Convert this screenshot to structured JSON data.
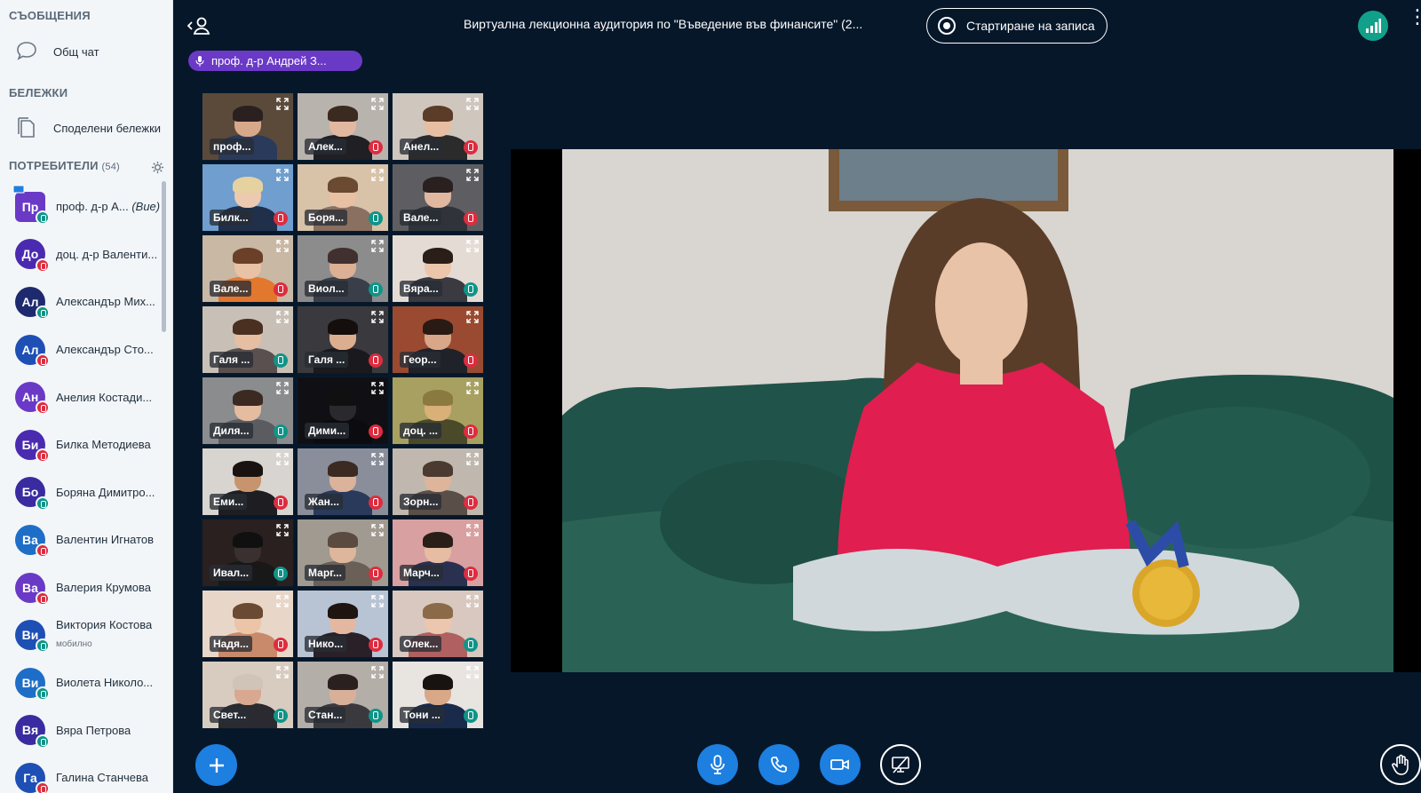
{
  "sidebar": {
    "messages_title": "СЪОБЩЕНИЯ",
    "public_chat": "Общ чат",
    "notes_title": "БЕЛЕЖКИ",
    "shared_notes": "Споделени бележки",
    "users_title": "ПОТРЕБИТЕЛИ",
    "users_count": "(54)",
    "users": [
      {
        "initials": "Пр",
        "name": "проф. д-р А...",
        "suffix": "(Вие)",
        "status": "listen",
        "color": "#6a3ac6",
        "presenter": true
      },
      {
        "initials": "До",
        "name": "доц. д-р Валенти...",
        "status": "mute",
        "color": "#4a2bb0"
      },
      {
        "initials": "Ал",
        "name": "Александър Мих...",
        "status": "listen",
        "color": "#1e2a6e"
      },
      {
        "initials": "Ал",
        "name": "Александър Сто...",
        "status": "mute",
        "color": "#1e4fb5"
      },
      {
        "initials": "Ан",
        "name": "Анелия Костади...",
        "status": "mute",
        "color": "#6a3ac6"
      },
      {
        "initials": "Би",
        "name": "Билка Методиева",
        "status": "mute",
        "color": "#4a2bb0"
      },
      {
        "initials": "Бо",
        "name": "Боряна Димитро...",
        "status": "listen",
        "color": "#3a2ba0"
      },
      {
        "initials": "Ва",
        "name": "Валентин Игнатов",
        "status": "mute",
        "color": "#1e6ec8"
      },
      {
        "initials": "Ва",
        "name": "Валерия Крумова",
        "status": "mute",
        "color": "#6a3ac6"
      },
      {
        "initials": "Ви",
        "name": "Виктория Костова",
        "sub": "мобилно",
        "status": "listen",
        "color": "#1e4fb5"
      },
      {
        "initials": "Ви",
        "name": "Виолета Николо...",
        "status": "listen",
        "color": "#1e6ec8"
      },
      {
        "initials": "Вя",
        "name": "Вяра Петрова",
        "status": "listen",
        "color": "#3a2ba0"
      },
      {
        "initials": "Га",
        "name": "Галина Станчева",
        "status": "mute",
        "color": "#1e4fb5"
      }
    ]
  },
  "header": {
    "title": "Виртуална лекционна аудитория по \"Въведение във финансите\" (2...",
    "record_label": "Стартиране на записа",
    "talker": "проф. д-р Андрей З..."
  },
  "tiles": [
    {
      "name": "проф...",
      "status": "none",
      "bg": "#5b4a3a",
      "skin": "#d8a88a",
      "hair": "#2a2020",
      "shirt": "#2a3a5a"
    },
    {
      "name": "Алек...",
      "status": "mute",
      "bg": "#b9b3ad",
      "skin": "#e2b8a0",
      "hair": "#3b2a20",
      "shirt": "#1f1f24"
    },
    {
      "name": "Анел...",
      "status": "mute",
      "bg": "#cfc6bd",
      "skin": "#e8bea2",
      "hair": "#5a3c28",
      "shirt": "#2b2b2b"
    },
    {
      "name": "Билк...",
      "status": "mute",
      "bg": "#6f9ecf",
      "skin": "#ecc9b0",
      "hair": "#e5d2a0",
      "shirt": "#20304a"
    },
    {
      "name": "Боря...",
      "status": "listen",
      "bg": "#d8c2a8",
      "skin": "#e8c0a4",
      "hair": "#6a4a30",
      "shirt": "#8a7060"
    },
    {
      "name": "Вале...",
      "status": "mute",
      "bg": "#5e5e62",
      "skin": "#e0b8a0",
      "hair": "#2a2020",
      "shirt": "#30343a"
    },
    {
      "name": "Вале...",
      "status": "mute",
      "bg": "#c8b8a4",
      "skin": "#e9c2a5",
      "hair": "#6a4028",
      "shirt": "#e2772e"
    },
    {
      "name": "Виол...",
      "status": "listen",
      "bg": "#8c8c8c",
      "skin": "#dcb094",
      "hair": "#403030",
      "shirt": "#3a3e48"
    },
    {
      "name": "Вяра...",
      "status": "listen",
      "bg": "#e4dcd4",
      "skin": "#ecc6aa",
      "hair": "#2a1e18",
      "shirt": "#3a3a40"
    },
    {
      "name": "Галя ...",
      "status": "listen",
      "bg": "#c8c0b6",
      "skin": "#e6bea2",
      "hair": "#4a3020",
      "shirt": "#5a5050"
    },
    {
      "name": "Галя ...",
      "status": "mute",
      "bg": "#3a3a3e",
      "skin": "#dcae90",
      "hair": "#140e0c",
      "shirt": "#1a1a1e"
    },
    {
      "name": "Геор...",
      "status": "mute",
      "bg": "#9a4a30",
      "skin": "#d8a688",
      "hair": "#2a1a14",
      "shirt": "#20222a"
    },
    {
      "name": "Диля...",
      "status": "listen",
      "bg": "#8a8c8e",
      "skin": "#e4bca0",
      "hair": "#3a2a22",
      "shirt": "#5a5c60"
    },
    {
      "name": "Дими...",
      "status": "mute",
      "bg": "#101014",
      "skin": "#2a2a2e",
      "hair": "#101010",
      "shirt": "#0c0c10"
    },
    {
      "name": "доц. ...",
      "status": "mute",
      "bg": "#a8a060",
      "skin": "#d8b078",
      "hair": "#8a7a40",
      "shirt": "#4a4a2a"
    },
    {
      "name": "Еми...",
      "status": "mute",
      "bg": "#d8d4d0",
      "skin": "#c8946e",
      "hair": "#1a1210",
      "shirt": "#1e1e22"
    },
    {
      "name": "Жан...",
      "status": "mute",
      "bg": "#8a8e9a",
      "skin": "#dcb29a",
      "hair": "#3a2a22",
      "shirt": "#2a3a5a"
    },
    {
      "name": "Зорн...",
      "status": "mute",
      "bg": "#c0b8ae",
      "skin": "#deb49a",
      "hair": "#4a3a30",
      "shirt": "#5a4e48"
    },
    {
      "name": "Ивал...",
      "status": "listen",
      "bg": "#2a2020",
      "skin": "#3a3030",
      "hair": "#101010",
      "shirt": "#181818"
    },
    {
      "name": "Марг...",
      "status": "mute",
      "bg": "#a09a90",
      "skin": "#deb69c",
      "hair": "#5a4a40",
      "shirt": "#6a6058"
    },
    {
      "name": "Марч...",
      "status": "mute",
      "bg": "#d8a0a0",
      "skin": "#e6bca2",
      "hair": "#2a1e18",
      "shirt": "#2a3050"
    },
    {
      "name": "Надя...",
      "status": "mute",
      "bg": "#e8d6c8",
      "skin": "#ecc4a8",
      "hair": "#6a4a32",
      "shirt": "#c88a6a"
    },
    {
      "name": "Нико...",
      "status": "mute",
      "bg": "#b8c4d4",
      "skin": "#e4b8a0",
      "hair": "#1e1410",
      "shirt": "#2a2028"
    },
    {
      "name": "Олек...",
      "status": "listen",
      "bg": "#d8c8c0",
      "skin": "#ecc6ae",
      "hair": "#8a6a48",
      "shirt": "#b06060"
    },
    {
      "name": "Свет...",
      "status": "listen",
      "bg": "#d8ccc0",
      "skin": "#d8a890",
      "hair": "#d0c4b8",
      "shirt": "#2a2a30"
    },
    {
      "name": "Стан...",
      "status": "listen",
      "bg": "#b4aea8",
      "skin": "#d8b09a",
      "hair": "#2a2020",
      "shirt": "#3a3a3e"
    },
    {
      "name": "Тони ...",
      "status": "listen",
      "bg": "#e8e4e0",
      "skin": "#d8a888",
      "hair": "#181210",
      "shirt": "#1a2a4a"
    }
  ],
  "colors": {
    "background": "#06172a",
    "accent_blue": "#1d7fe0",
    "talker_purple": "#6a3ac6",
    "mute_red": "#de2c3f",
    "listen_teal": "#0f9488"
  }
}
